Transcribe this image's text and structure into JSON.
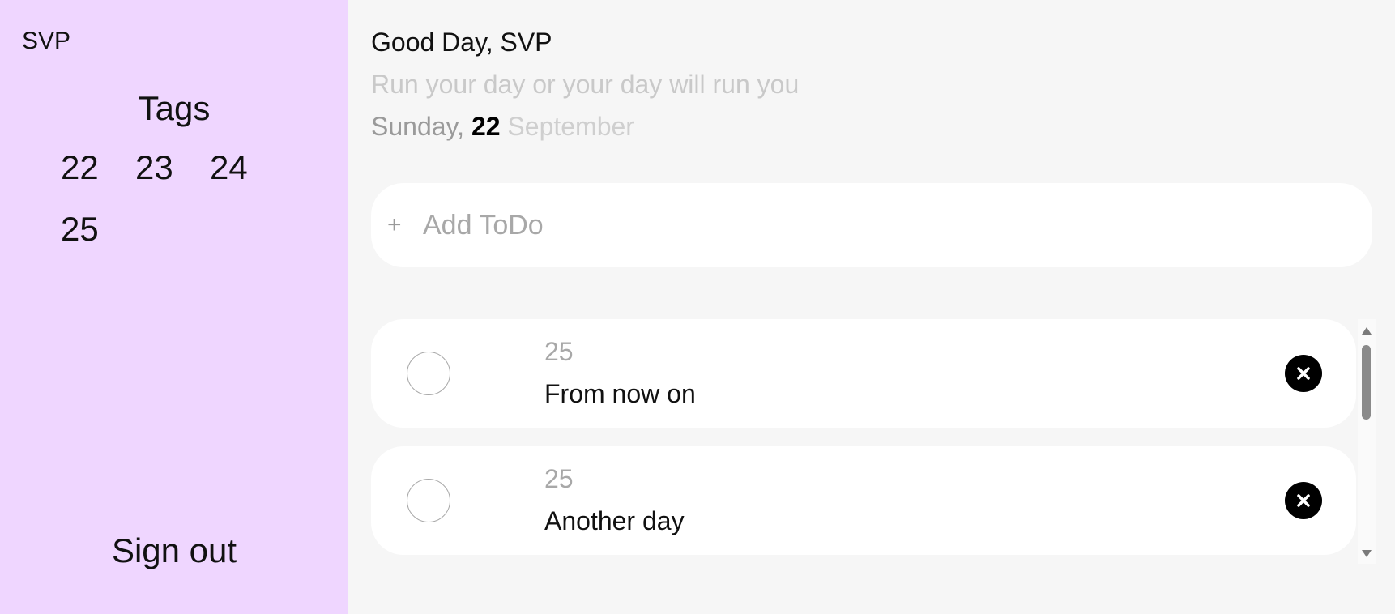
{
  "sidebar": {
    "user_name": "SVP",
    "tags_title": "Tags",
    "tags": [
      "22",
      "23",
      "24",
      "25"
    ],
    "sign_out": "Sign out",
    "background": "#efd6ff"
  },
  "header": {
    "greeting": "Good Day, SVP",
    "motto": "Run your day or your day will run you",
    "date": {
      "weekday": "Sunday,",
      "day": "22",
      "month": "September"
    }
  },
  "add_todo": {
    "plus_icon": "+",
    "placeholder": "Add ToDo"
  },
  "todos": [
    {
      "tag": "25",
      "title": "From now on",
      "completed": false
    },
    {
      "tag": "25",
      "title": "Another day",
      "completed": false
    }
  ],
  "icons": {
    "check": "circle-outline",
    "delete": "close-circle-filled"
  }
}
